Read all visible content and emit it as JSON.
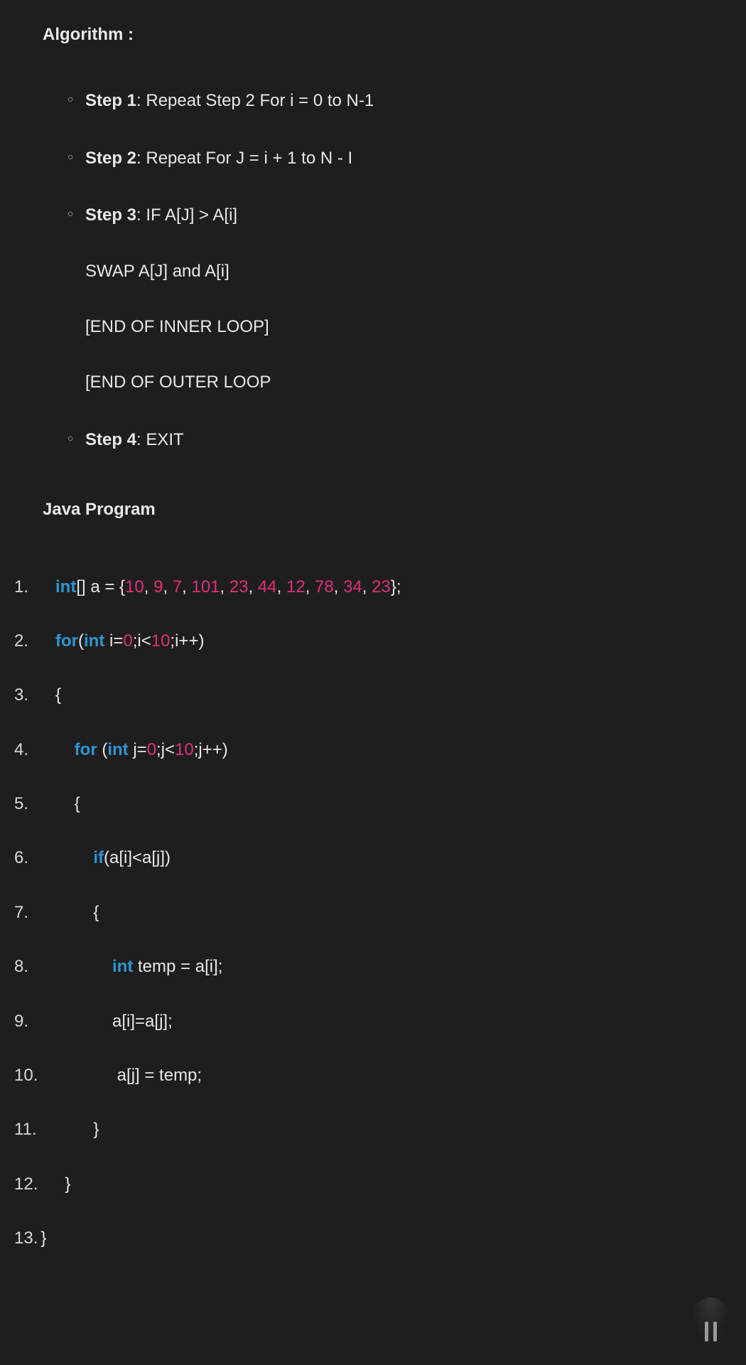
{
  "algorithm": {
    "heading": "Algorithm :",
    "steps": [
      {
        "label": "Step 1",
        "text": ": Repeat Step 2 For i = 0 to N-1"
      },
      {
        "label": "Step 2",
        "text": ": Repeat For J = i + 1 to N - I"
      },
      {
        "label": "Step 3",
        "text": ": IF A[J] > A[i]",
        "sub": [
          "SWAP A[J] and A[i]",
          "[END OF INNER LOOP]",
          "[END OF OUTER LOOP"
        ]
      },
      {
        "label": "Step 4",
        "text": ": EXIT"
      }
    ]
  },
  "java": {
    "heading": "Java Program",
    "lines": [
      {
        "n": "1.",
        "tokens": [
          {
            "c": "kw",
            "t": "int"
          },
          {
            "t": "[] a = {"
          },
          {
            "c": "num",
            "t": "10"
          },
          {
            "t": ", "
          },
          {
            "c": "num",
            "t": "9"
          },
          {
            "t": ", "
          },
          {
            "c": "num",
            "t": "7"
          },
          {
            "t": ", "
          },
          {
            "c": "num",
            "t": "101"
          },
          {
            "t": ", "
          },
          {
            "c": "num",
            "t": "23"
          },
          {
            "t": ", "
          },
          {
            "c": "num",
            "t": "44"
          },
          {
            "t": ", "
          },
          {
            "c": "num",
            "t": "12"
          },
          {
            "t": ", "
          },
          {
            "c": "num",
            "t": "78"
          },
          {
            "t": ", "
          },
          {
            "c": "num",
            "t": "34"
          },
          {
            "t": ", "
          },
          {
            "c": "num",
            "t": "23"
          },
          {
            "t": "};"
          }
        ]
      },
      {
        "n": "2.",
        "tokens": [
          {
            "c": "kw",
            "t": "for"
          },
          {
            "t": "("
          },
          {
            "c": "kw",
            "t": "int"
          },
          {
            "t": " i="
          },
          {
            "c": "num",
            "t": "0"
          },
          {
            "t": ";i<"
          },
          {
            "c": "num",
            "t": "10"
          },
          {
            "t": ";i++)"
          }
        ]
      },
      {
        "n": "3.",
        "tokens": [
          {
            "t": "{"
          }
        ]
      },
      {
        "n": "4.",
        "tokens": [
          {
            "t": "    "
          },
          {
            "c": "kw",
            "t": "for"
          },
          {
            "t": " ("
          },
          {
            "c": "kw",
            "t": "int"
          },
          {
            "t": " j="
          },
          {
            "c": "num",
            "t": "0"
          },
          {
            "t": ";j<"
          },
          {
            "c": "num",
            "t": "10"
          },
          {
            "t": ";j++)"
          }
        ]
      },
      {
        "n": "5.",
        "tokens": [
          {
            "t": "    {"
          }
        ]
      },
      {
        "n": "6.",
        "tokens": [
          {
            "t": "        "
          },
          {
            "c": "kw",
            "t": "if"
          },
          {
            "t": "(a[i]<a[j])"
          }
        ]
      },
      {
        "n": "7.",
        "tokens": [
          {
            "t": "        {"
          }
        ]
      },
      {
        "n": "8.",
        "tokens": [
          {
            "t": "            "
          },
          {
            "c": "kw",
            "t": "int"
          },
          {
            "t": " temp = a[i];"
          }
        ]
      },
      {
        "n": "9.",
        "tokens": [
          {
            "t": "            a[i]=a[j];"
          }
        ]
      },
      {
        "n": "10.",
        "tokens": [
          {
            "t": "             a[j] = temp;"
          }
        ]
      },
      {
        "n": "11.",
        "tokens": [
          {
            "t": "        }"
          }
        ]
      },
      {
        "n": "12.",
        "tokens": [
          {
            "t": "  }"
          }
        ]
      },
      {
        "n": "13.",
        "tokens": [
          {
            "t": "}"
          }
        ],
        "nobreak": true
      }
    ]
  }
}
